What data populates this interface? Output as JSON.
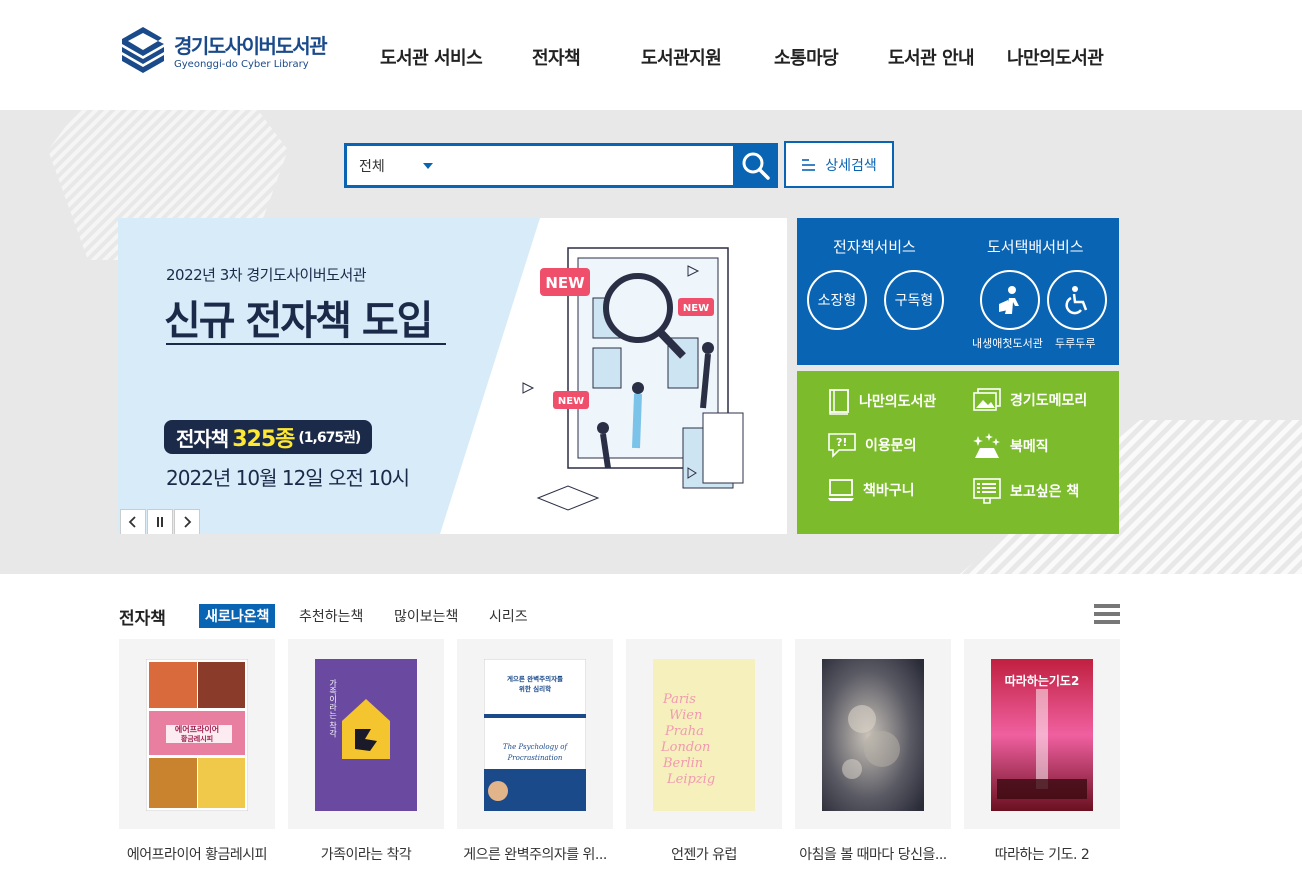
{
  "logo": {
    "title_kr": "경기도사이버도서관",
    "title_en": "Gyeonggi-do Cyber Library"
  },
  "nav": [
    {
      "label": "도서관 서비스"
    },
    {
      "label": "전자책"
    },
    {
      "label": "도서관지원"
    },
    {
      "label": "소통마당"
    },
    {
      "label": "도서관 안내"
    },
    {
      "label": "나만의도서관"
    }
  ],
  "search": {
    "scope": "전체",
    "query": "",
    "advanced_label": "상세검색"
  },
  "banner": {
    "line1": "2022년 3차 경기도사이버도서관",
    "title": "신규 전자책 도입",
    "pill_prefix": "전자책",
    "pill_count": "325종",
    "pill_volumes": "(1,675권)",
    "date": "2022년 10월 12일 오전 10시",
    "badges": [
      "NEW",
      "NEW",
      "NEW"
    ]
  },
  "services": {
    "ebook_heading": "전자책서비스",
    "delivery_heading": "도서택배서비스",
    "ebook_buttons": [
      "소장형",
      "구독형"
    ],
    "delivery_labels": [
      "내생애첫도서관",
      "두루두루"
    ]
  },
  "quick_links": [
    {
      "label": "나만의도서관",
      "icon": "book-icon"
    },
    {
      "label": "경기도메모리",
      "icon": "photos-icon"
    },
    {
      "label": "이용문의",
      "icon": "question-icon"
    },
    {
      "label": "북메직",
      "icon": "sparkle-icon"
    },
    {
      "label": "책바구니",
      "icon": "monitor-icon"
    },
    {
      "label": "보고싶은 책",
      "icon": "list-icon"
    }
  ],
  "ebooks": {
    "section_title": "전자책",
    "tabs": [
      "새로나온책",
      "추천하는책",
      "많이보는책",
      "시리즈"
    ],
    "active_tab": 0,
    "books": [
      {
        "title": "에어프라이어 황금레시피",
        "cover_text": "에어프라이어\n황금레시피"
      },
      {
        "title": "가족이라는 착각",
        "cover_text": "가족이라는 착각"
      },
      {
        "title": "게으른 완벽주의자를 위...",
        "cover_text": "게으른 완벽주의자를\n위한 심리학",
        "cover_text_en": "The Psychology of\nProcrastination"
      },
      {
        "title": "언젠가 유럽",
        "cover_text": "Paris Wien Praha London Berlin Leipzig"
      },
      {
        "title": "아침을 볼 때마다 당신을...",
        "cover_text": ""
      },
      {
        "title": "따라하는 기도. 2",
        "cover_text": "따라하는 기도2"
      }
    ]
  },
  "colors": {
    "primary": "#0a64b4",
    "green": "#7cbc2c",
    "navy": "#1c2a4a",
    "banner_bg": "#d7ecf8",
    "visual_bg": "#e8e8e8"
  }
}
